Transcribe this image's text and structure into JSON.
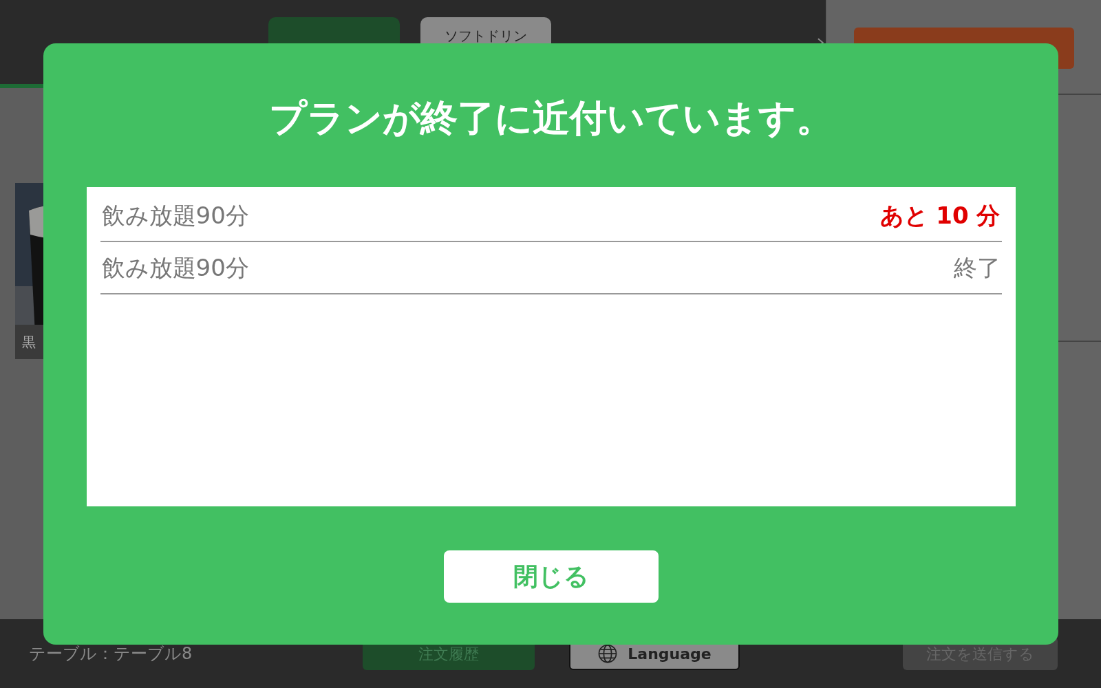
{
  "category_tabs": [
    {
      "selected": true
    },
    {
      "label": "ソフトドリン",
      "selected": false
    }
  ],
  "menu_items": [
    {
      "kind": "picture",
      "name": "黒"
    }
  ],
  "footer": {
    "table_label": "テーブル：テーブル8",
    "history_button": "注文履歴",
    "language_button": "Language",
    "send_button": "注文を送信する"
  },
  "dialog": {
    "title": "プランが終了に近付いています。",
    "plans": [
      {
        "name": "飲み放題90分",
        "status": "あと 10 分",
        "kind": "remaining"
      },
      {
        "name": "飲み放題90分",
        "status": "終了",
        "kind": "ended"
      }
    ],
    "close_button": "閉じる"
  }
}
